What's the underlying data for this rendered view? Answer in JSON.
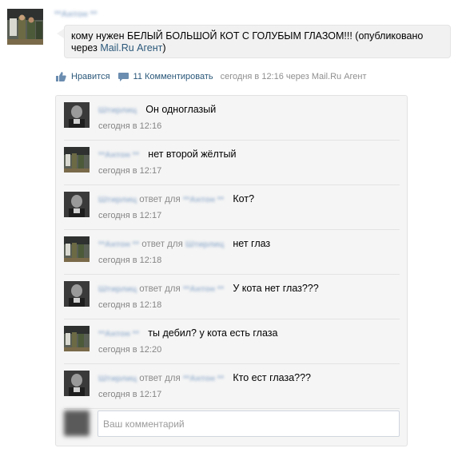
{
  "post": {
    "author": "**Антон **",
    "text_before_link": "кому нужен БЕЛЫЙ БОЛЬШОЙ КОТ С ГОЛУБЫМ ГЛАЗОМ!!! (опубликовано через ",
    "link_text": "Mail.Ru Агент",
    "text_after_link": ")"
  },
  "actions": {
    "like_label": "Нравится",
    "comments_label": "11 Комментировать",
    "meta": "сегодня в 12:16 через Mail.Ru Агент"
  },
  "comments": [
    {
      "author": "Штирлиц",
      "reply_word": "",
      "reply_to": "",
      "text": "Он одноглазый",
      "time": "сегодня в 12:16"
    },
    {
      "author": "**Антон **",
      "reply_word": "",
      "reply_to": "",
      "text": "нет второй жёлтый",
      "time": "сегодня в 12:17"
    },
    {
      "author": "Штирлиц",
      "reply_word": "ответ для",
      "reply_to": "**Антон **",
      "text": "Кот?",
      "time": "сегодня в 12:17"
    },
    {
      "author": "**Антон **",
      "reply_word": "ответ для",
      "reply_to": "Штирлиц",
      "text": "нет глаз",
      "time": "сегодня в 12:18"
    },
    {
      "author": "Штирлиц",
      "reply_word": "ответ для",
      "reply_to": "**Антон **",
      "text": "У кота нет глаз???",
      "time": "сегодня в 12:18"
    },
    {
      "author": "**Антон **",
      "reply_word": "",
      "reply_to": "",
      "text": "ты дебил? у кота есть глаза",
      "time": "сегодня в 12:20"
    },
    {
      "author": "Штирлиц",
      "reply_word": "ответ для",
      "reply_to": "**Антон **",
      "text": "Кто  ест  глаза???",
      "time": "сегодня в 12:17"
    }
  ],
  "input": {
    "placeholder": "Ваш комментарий"
  },
  "colors": {
    "link": "#2b587a",
    "meta": "#8f8f8f",
    "panel_bg": "#f5f5f5"
  },
  "icons": [
    "like-icon",
    "comment-icon"
  ]
}
